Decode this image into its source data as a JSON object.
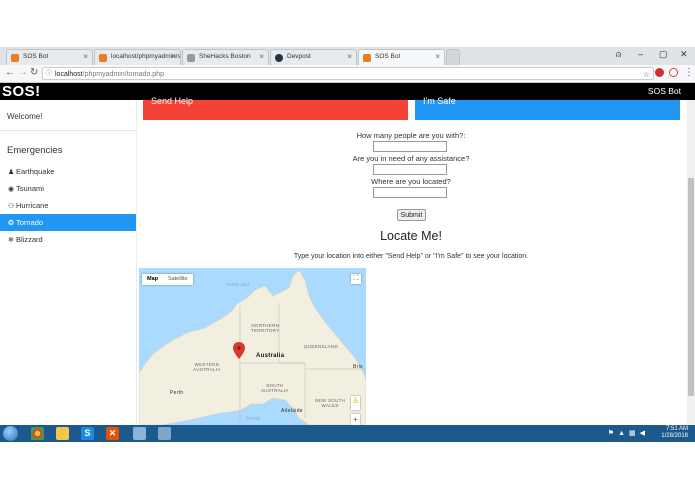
{
  "browser": {
    "tabs": [
      {
        "title": "SOS Bot",
        "active": false,
        "color": "#e67e22"
      },
      {
        "title": "localhost/phpmyadmin/s",
        "active": false,
        "color": "#e67e22"
      },
      {
        "title": "SheHacks Boston",
        "active": false,
        "color": "#999999"
      },
      {
        "title": "Devpost",
        "active": false,
        "color": "#223344"
      },
      {
        "title": "SOS Bot",
        "active": true,
        "color": "#e67e22"
      }
    ],
    "url_host": "localhost",
    "url_path": "/phpmyadmin/tornado.php"
  },
  "site": {
    "logo": "SOS!",
    "brand": "SOS Bot"
  },
  "sidebar": {
    "welcome": "Welcome!",
    "heading": "Emergencies",
    "items": [
      {
        "label": "Earthquake",
        "icon": "person-icon",
        "glyph": "♟",
        "active": false
      },
      {
        "label": "Tsunami",
        "icon": "eye-icon",
        "glyph": "◉",
        "active": false
      },
      {
        "label": "Hurricane",
        "icon": "users-icon",
        "glyph": "⚇",
        "active": false
      },
      {
        "label": "Tornado",
        "icon": "tornado-icon",
        "glyph": "❂",
        "active": true
      },
      {
        "label": "Blizzard",
        "icon": "snowflake-icon",
        "glyph": "❄",
        "active": false
      }
    ]
  },
  "main": {
    "send_help": "Send Help",
    "im_safe": "I'm Safe",
    "q1": "How many people are you with?:",
    "q2": "Are you in need of any assistance?",
    "q3": "Where are you located?",
    "submit": "Submit",
    "locate_title": "Locate Me!",
    "instructions": "Type your location into either \"Send Help\" or \"I'm Safe\" to see your location."
  },
  "map": {
    "type_map": "Map",
    "type_satellite": "Satellite",
    "labels": {
      "timor_sea": "Timor Sea",
      "northern_territory": "NORTHERN\nTERRITORY",
      "queensland": "QUEENSLAND",
      "western_australia": "WESTERN\nAUSTRALIA",
      "south_australia": "SOUTH\nAUSTRALIA",
      "new_south_wales": "NEW SOUTH\nWALES",
      "country": "Australia",
      "perth": "Perth",
      "adelaide": "Adelaide",
      "bris": "Bris",
      "great": "Great"
    },
    "land_color": "#f3efe0",
    "water_color": "#aadaff",
    "marker_color": "#d93a2b"
  },
  "taskbar": {
    "time": "7:51 AM",
    "date": "1/28/2018"
  },
  "colors": {
    "send_help": "#f44336",
    "im_safe": "#2196f3",
    "active_sidebar": "#2196f3"
  }
}
